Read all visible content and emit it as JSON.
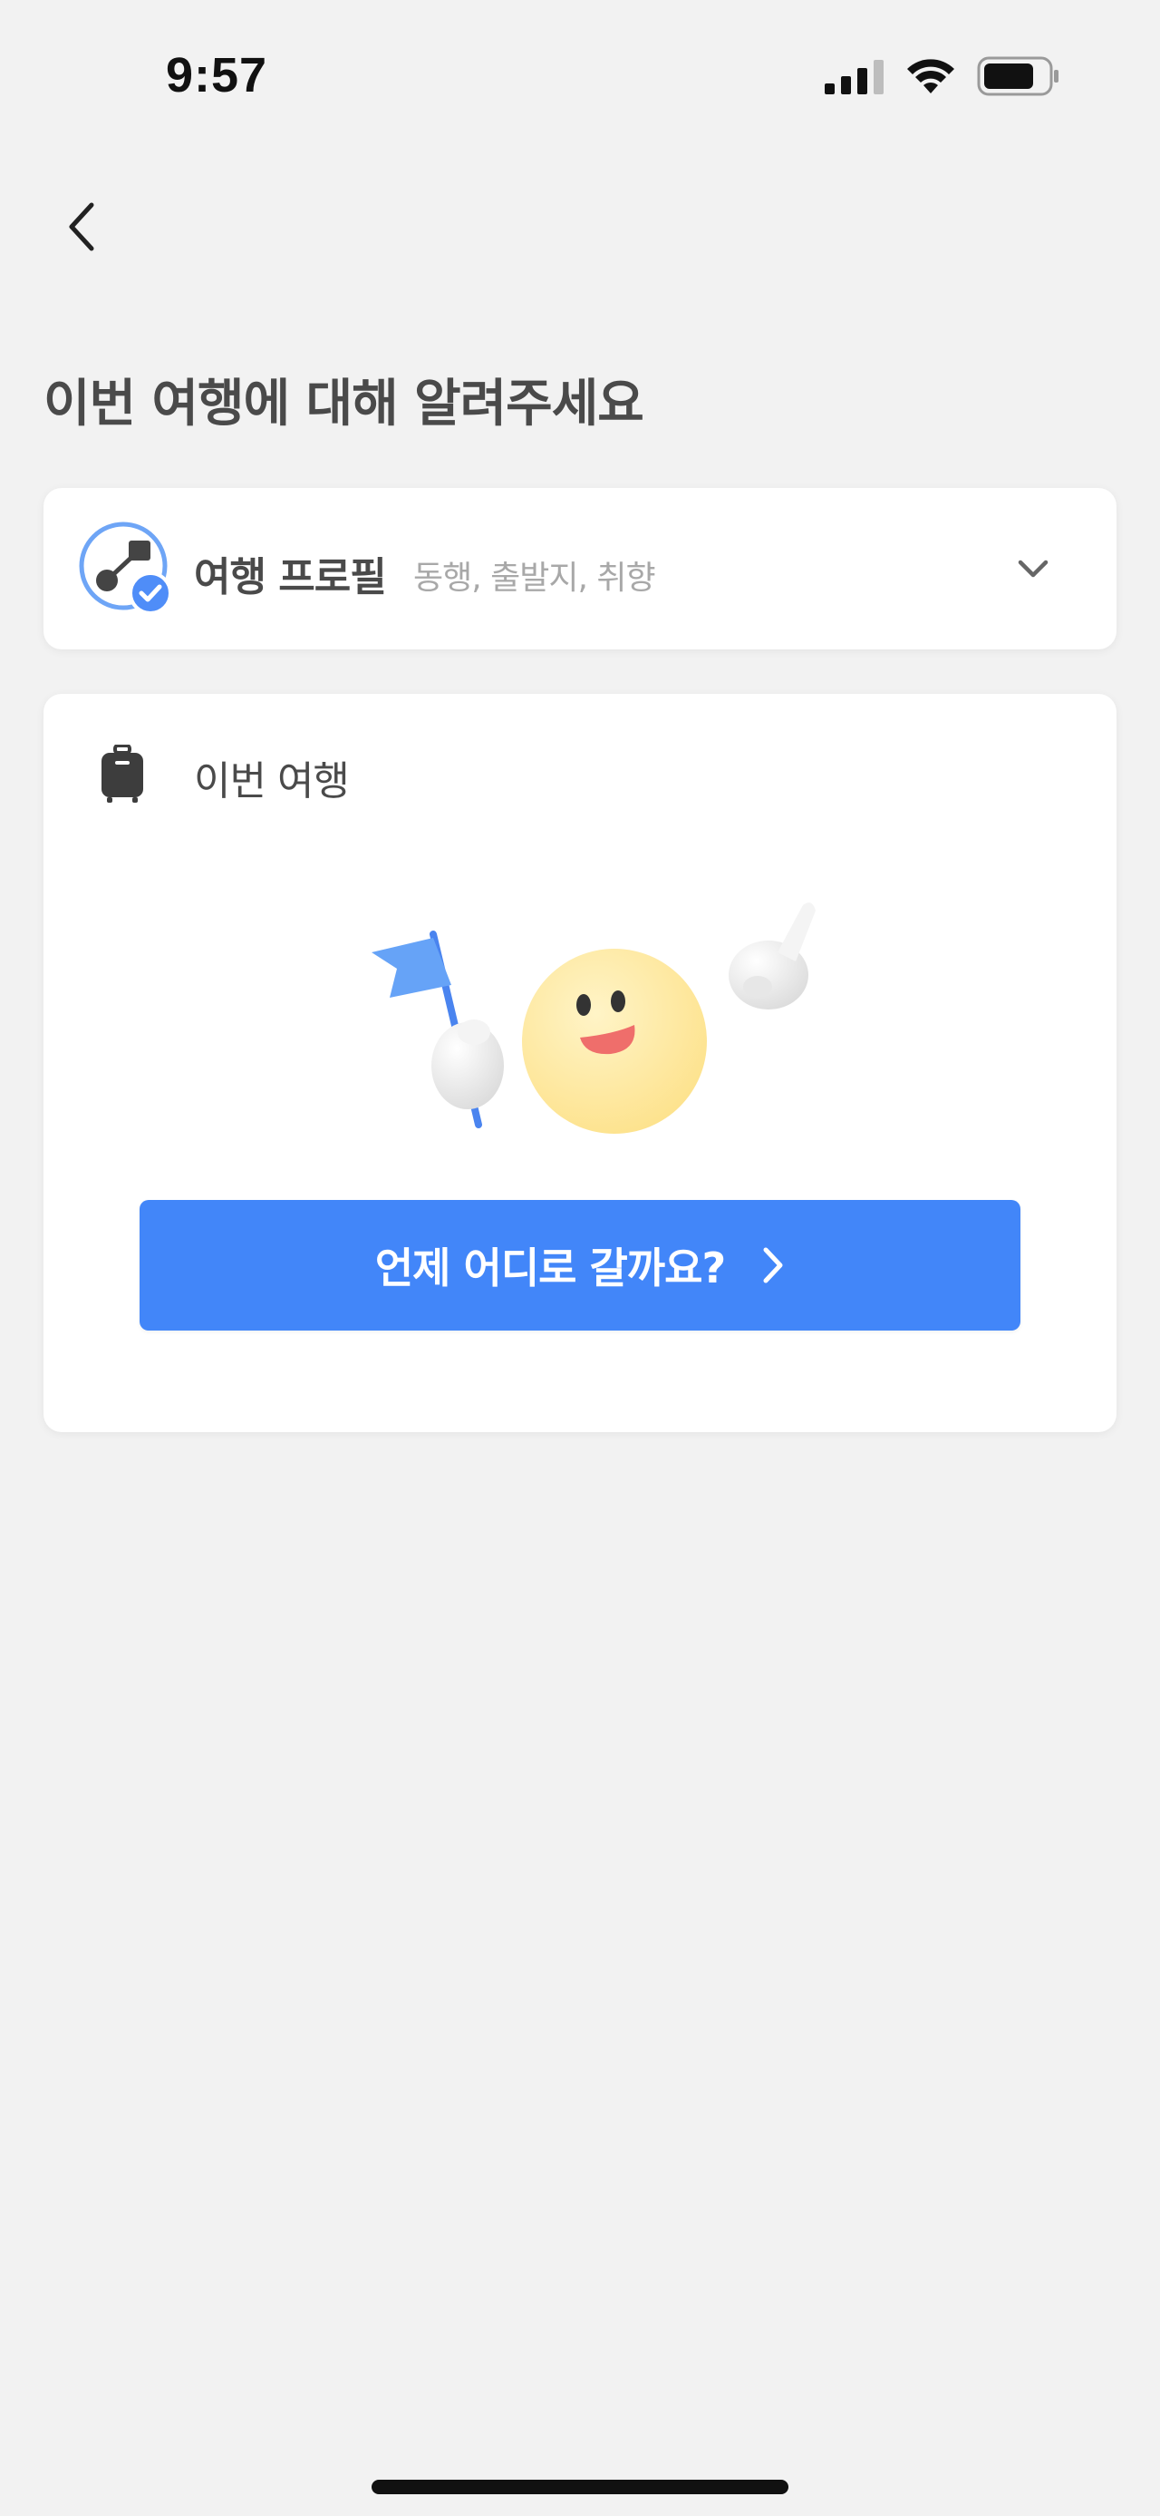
{
  "status_bar": {
    "time": "9:57",
    "signal_icon": "cellular-signal-icon",
    "wifi_icon": "wifi-icon",
    "battery_icon": "battery-icon"
  },
  "nav": {
    "back_icon": "chevron-left-icon"
  },
  "page": {
    "title": "이번 여행에 대해 알려주세요"
  },
  "profile_card": {
    "icon": "travel-profile-icon",
    "title": "여행 프로필",
    "subtitle": "동행, 출발지, 취향",
    "expand_icon": "chevron-down-icon"
  },
  "trip_card": {
    "icon": "suitcase-icon",
    "label": "이번 여행",
    "illustration": "smiley-with-flag-illustration",
    "cta_label": "언제 어디로 갈까요?",
    "cta_icon": "chevron-right-icon"
  },
  "colors": {
    "background": "#f2f2f2",
    "card": "#ffffff",
    "accent": "#4286f9",
    "title_text": "#4a4a4a",
    "muted_text": "#a8a8a8"
  }
}
